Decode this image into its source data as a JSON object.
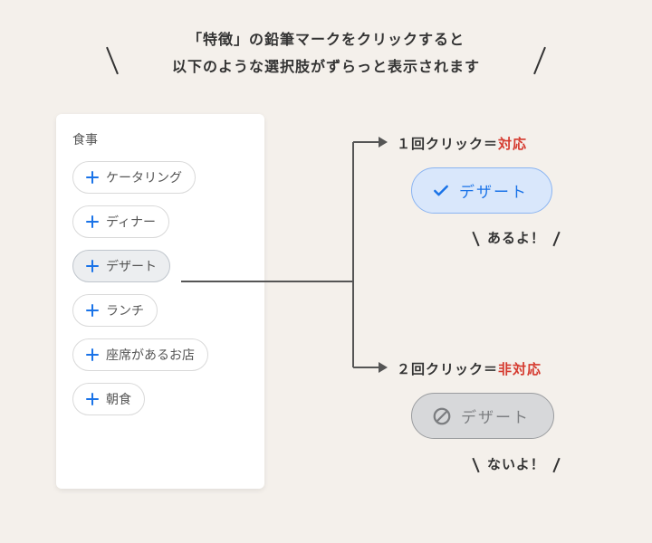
{
  "header": {
    "line1": "「特徴」の鉛筆マークをクリックすると",
    "line2": "以下のような選択肢がずらっと表示されます"
  },
  "panel": {
    "title": "食事",
    "options": [
      "ケータリング",
      "ディナー",
      "デザート",
      "ランチ",
      "座席があるお店",
      "朝食"
    ]
  },
  "result_on": {
    "label_prefix": "１回クリック＝",
    "label_status": "対応",
    "chip_text": "デザート",
    "exclaim": "あるよ！"
  },
  "result_off": {
    "label_prefix": "２回クリック＝",
    "label_status": "非対応",
    "chip_text": "デザート",
    "exclaim": "ないよ！"
  }
}
